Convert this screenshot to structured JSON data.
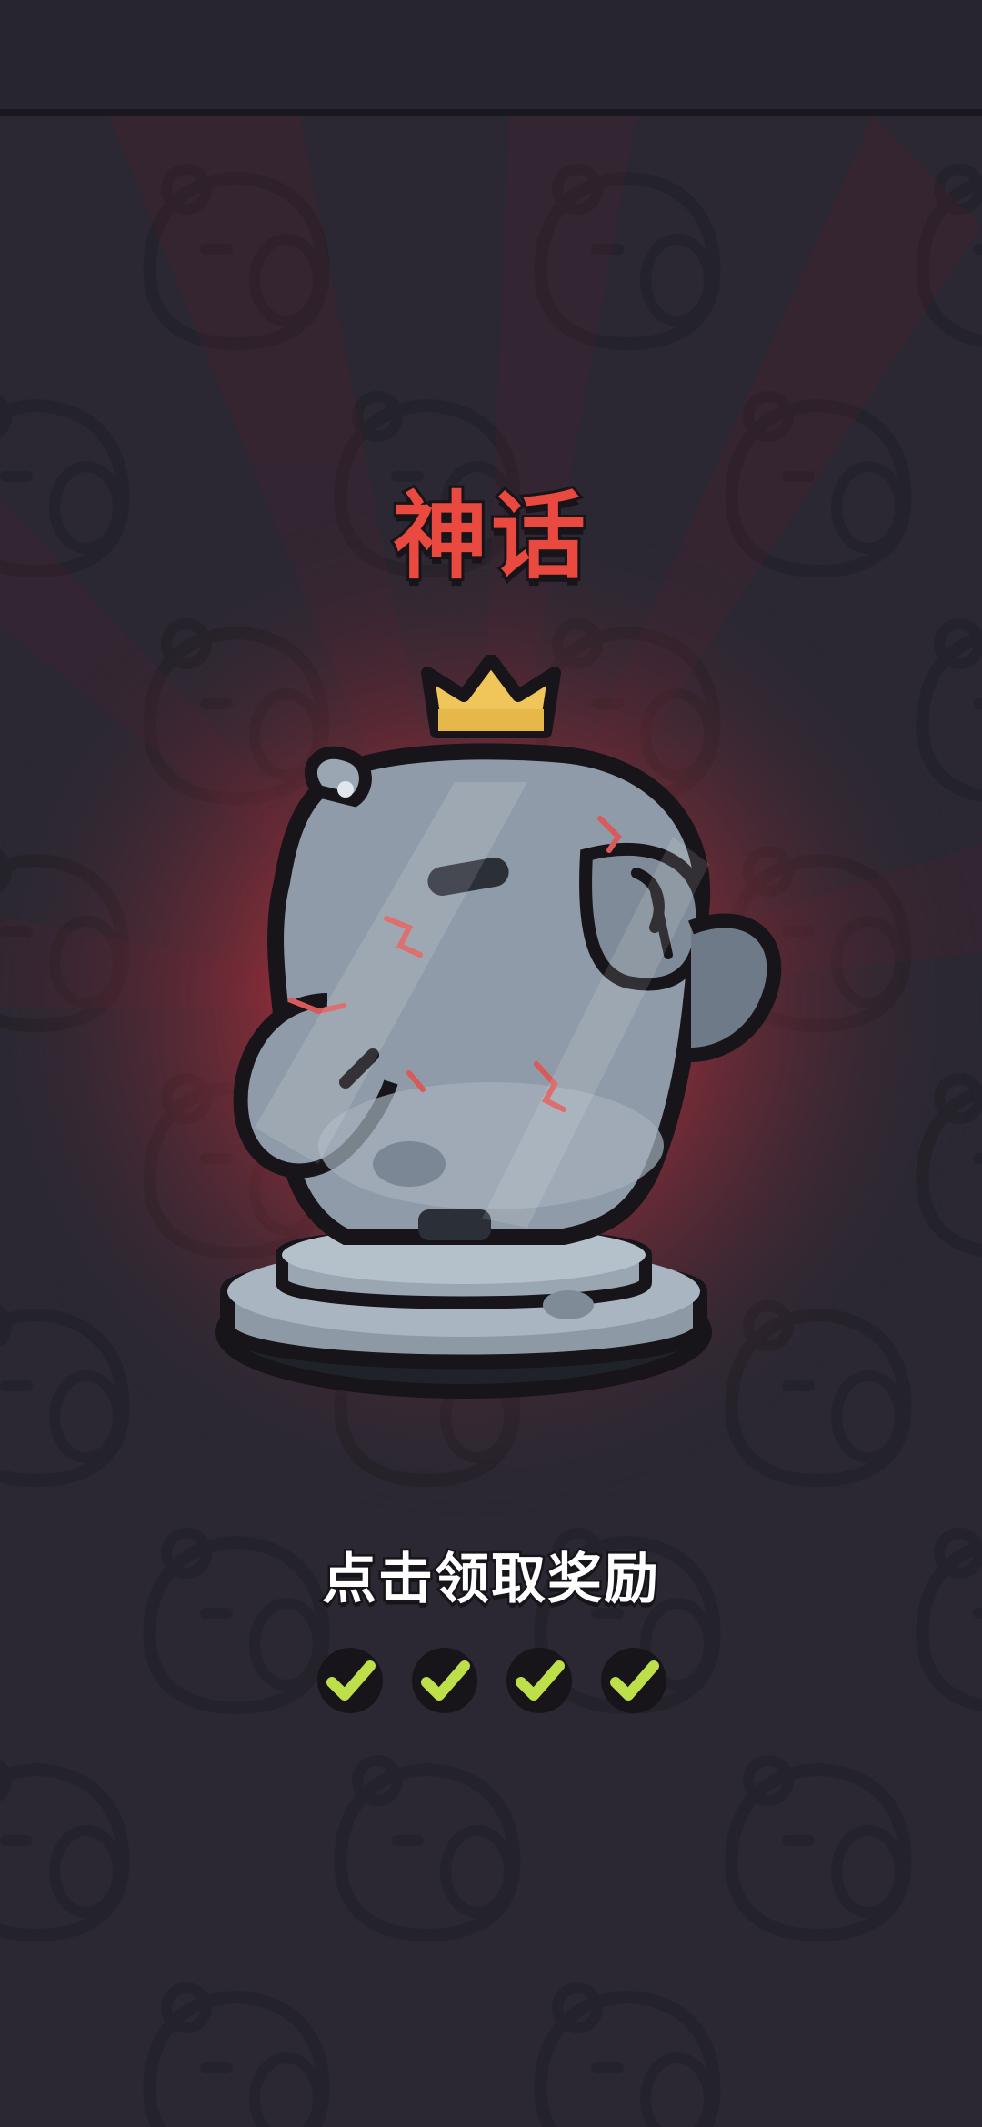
{
  "rarity": {
    "title": "神话",
    "color": "#e9493e"
  },
  "claim": {
    "label": "点击领取奖励"
  },
  "progress": {
    "completed": 4,
    "total": 4,
    "icon": "checkmark-icon",
    "check_color": "#bde04a"
  },
  "reward": {
    "icon": "crowned-capybara-statue-icon",
    "state": "cracked-stone"
  },
  "colors": {
    "background": "#2b2833",
    "glow": "#e03a3a"
  }
}
